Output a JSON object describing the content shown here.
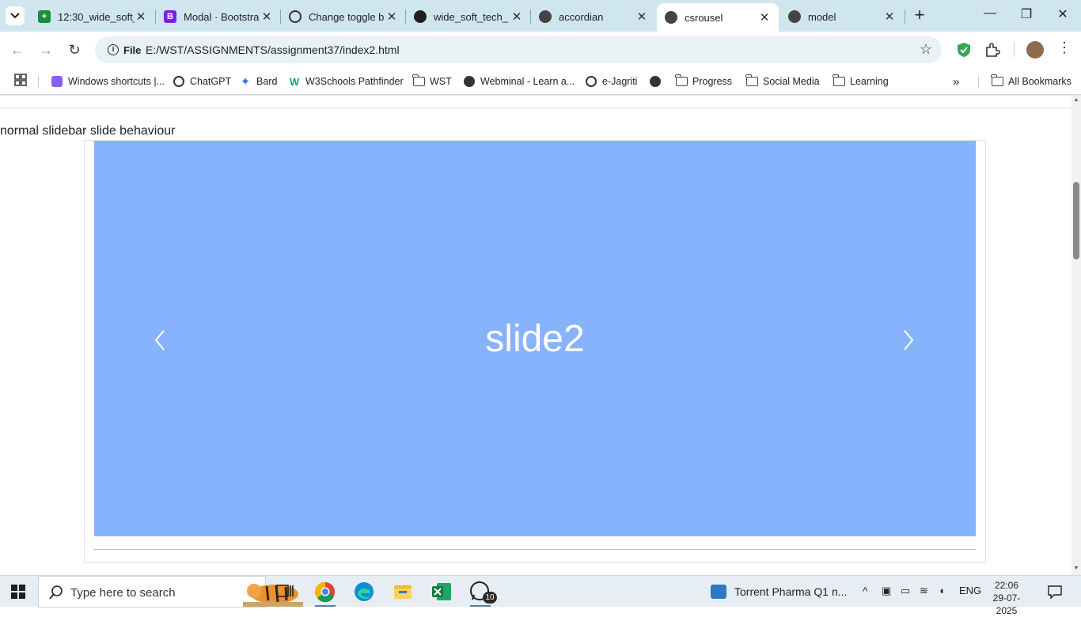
{
  "browser": {
    "tabs": [
      {
        "title": "12:30_wide_soft_",
        "icon": "google-sheets-icon",
        "color": "#1e8e3e",
        "active": false
      },
      {
        "title": "Modal · Bootstra",
        "icon": "bootstrap-icon",
        "color": "#7b1ff0",
        "active": false
      },
      {
        "title": "Change toggle b",
        "icon": "chatgpt-icon",
        "color": "#333333",
        "active": false
      },
      {
        "title": "wide_soft_tech_",
        "icon": "github-icon",
        "color": "#1f1f1f",
        "active": false
      },
      {
        "title": "accordian",
        "icon": "globe-icon",
        "color": "#333333",
        "active": false
      },
      {
        "title": "csrousel",
        "icon": "globe-icon",
        "color": "#333333",
        "active": true
      },
      {
        "title": "model",
        "icon": "globe-icon",
        "color": "#333333",
        "active": false
      }
    ],
    "address": {
      "chip_label": "File",
      "url": "E:/WST/ASSIGNMENTS/assignment37/index2.html"
    },
    "bookmarks": [
      {
        "label": "Windows shortcuts |...",
        "icon": "windows-shortcuts-icon"
      },
      {
        "label": "ChatGPT",
        "icon": "chatgpt-icon"
      },
      {
        "label": "Bard",
        "icon": "bard-icon"
      },
      {
        "label": "W3Schools Pathfinder",
        "icon": "w3schools-icon"
      },
      {
        "label": "WST",
        "icon": "folder-icon"
      },
      {
        "label": "Webminal - Learn a...",
        "icon": "globe-icon"
      },
      {
        "label": "e-Jagriti",
        "icon": "ejagriti-icon"
      },
      {
        "label": "",
        "icon": "globe-icon"
      },
      {
        "label": "Progress",
        "icon": "folder-icon"
      },
      {
        "label": "Social Media",
        "icon": "folder-icon"
      },
      {
        "label": "Learning",
        "icon": "folder-icon"
      },
      {
        "label": "All Bookmarks",
        "icon": "folder-icon"
      }
    ]
  },
  "page": {
    "caption": "normal slidebar slide behaviour",
    "slide_text": "slide2",
    "slide_color": "#86b3fb"
  },
  "taskbar": {
    "search_placeholder": "Type here to search",
    "news": "Torrent Pharma Q1 n...",
    "language": "ENG",
    "time": "22:06",
    "date": "29-07-2025",
    "whatsapp_badge": "10"
  }
}
